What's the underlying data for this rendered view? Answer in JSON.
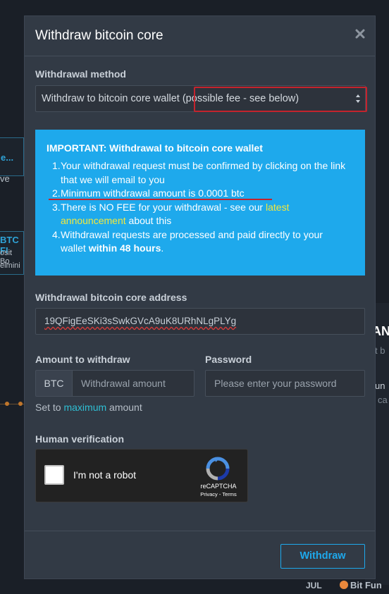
{
  "background": {
    "frag_1": "e...",
    "frag_2": "ve",
    "frag_3": "BTC FI",
    "frag_4": "osit Bo",
    "frag_5": "elmini",
    "frag_6": "AN",
    "frag_7": "t b",
    "frag_8": "un",
    "frag_9": "ca",
    "frag_10": "JUL",
    "frag_11": "Bit Fun"
  },
  "modal": {
    "title": "Withdraw bitcoin core",
    "close_icon": "close-icon"
  },
  "method": {
    "label": "Withdrawal method",
    "selected": "Withdraw to bitcoin core wallet (possible fee - see below)"
  },
  "notice": {
    "title": "IMPORTANT: Withdrawal to bitcoin core wallet",
    "items": [
      {
        "num": "1.",
        "text": "Your withdrawal request must be confirmed by clicking on the link that we will email to you"
      },
      {
        "num": "2.",
        "text": "Minimum withdrawal amount is 0.0001 btc"
      },
      {
        "num": "3.",
        "text_before": "There is NO FEE for your withdrawal - see our ",
        "link": "latest announcement",
        "text_after": " about this"
      },
      {
        "num": "4.",
        "text_before": "Withdrawal requests are processed and paid directly to your wallet ",
        "bold": "within 48 hours",
        "text_after": "."
      }
    ],
    "background_color": "#1ea9ec",
    "link_color": "#f3e83c"
  },
  "address": {
    "label": "Withdrawal bitcoin core address",
    "value": "19QFigEeSKi3sSwkGVcA9uK8URhNLgPLYg"
  },
  "amount": {
    "label": "Amount to withdraw",
    "prefix": "BTC",
    "placeholder": "Withdrawal amount",
    "set_text_before": "Set to ",
    "set_link": "maximum",
    "set_text_after": " amount"
  },
  "password": {
    "label": "Password",
    "placeholder": "Please enter your password"
  },
  "verification": {
    "label": "Human verification",
    "checkbox_label": "I'm not a robot",
    "brand": "reCAPTCHA",
    "terms": "Privacy - Terms"
  },
  "footer": {
    "withdraw_label": "Withdraw",
    "accent_color": "#1ea9ec"
  }
}
